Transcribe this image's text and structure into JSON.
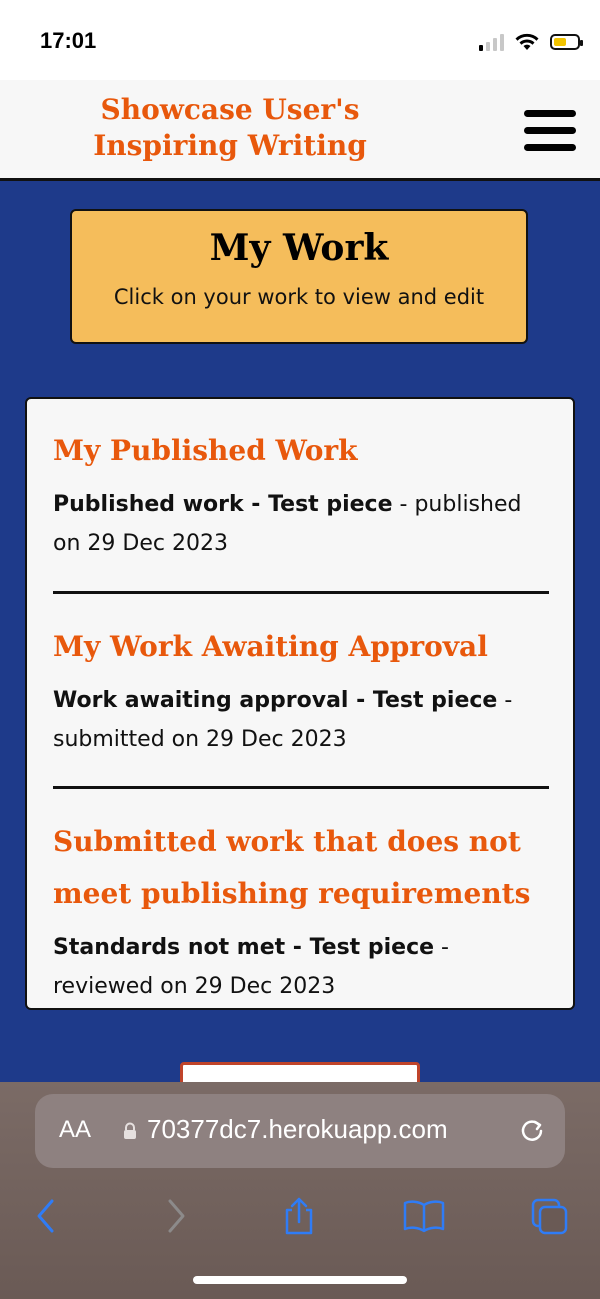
{
  "status": {
    "time": "17:01",
    "battery_level": 0.45
  },
  "header": {
    "title": "Showcase User's Inspiring Writing"
  },
  "hero": {
    "title": "My Work",
    "subtitle": "Click on your work to view and edit"
  },
  "sections": [
    {
      "heading": "My Published Work",
      "item_title": "Published work - Test piece",
      "item_meta": " - published on 29 Dec 2023"
    },
    {
      "heading": "My Work Awaiting Approval",
      "item_title": "Work awaiting approval - Test piece",
      "item_meta": " - submitted on 29 Dec 2023"
    },
    {
      "heading": "Submitted work that does not meet publishing requirements",
      "item_title": "Standards not met - Test piece",
      "item_meta": " - reviewed on 29 Dec 2023"
    }
  ],
  "browser": {
    "text_size": "AA",
    "url": "70377dc7.herokuapp.com"
  },
  "icons": [
    "signal-icon",
    "wifi-icon",
    "battery-icon",
    "hamburger-menu-icon",
    "lock-icon",
    "reload-icon",
    "back-icon",
    "forward-icon",
    "share-icon",
    "bookmarks-icon",
    "tabs-icon"
  ],
  "colors": {
    "accent": "#e8580c",
    "background": "#1e3a8a",
    "hero": "#f5bd5b",
    "link": "#2f7cf6"
  }
}
